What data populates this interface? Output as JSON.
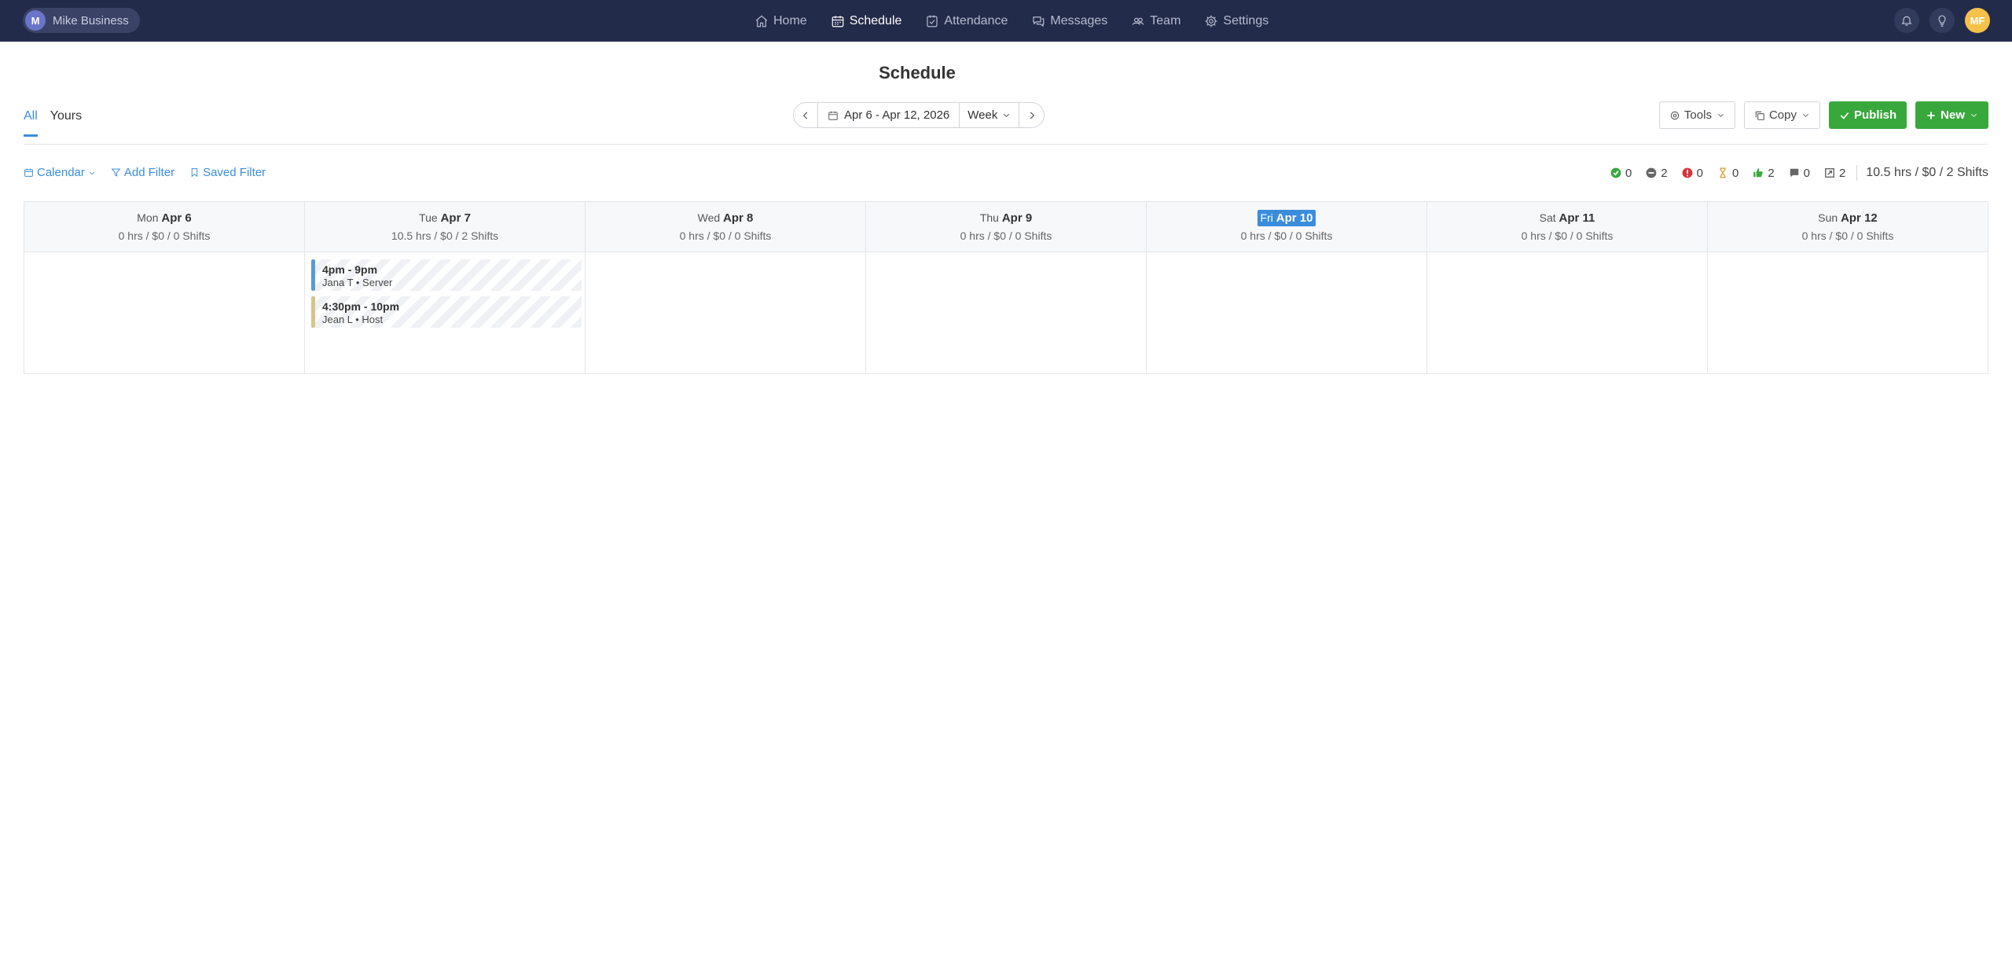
{
  "business": {
    "initial": "M",
    "name": "Mike Business"
  },
  "nav": [
    {
      "label": "Home",
      "icon": "home-icon"
    },
    {
      "label": "Schedule",
      "icon": "calendar-icon",
      "active": true
    },
    {
      "label": "Attendance",
      "icon": "clipboard-check-icon"
    },
    {
      "label": "Messages",
      "icon": "messages-icon"
    },
    {
      "label": "Team",
      "icon": "team-icon"
    },
    {
      "label": "Settings",
      "icon": "gear-icon"
    }
  ],
  "user": {
    "initials": "MF"
  },
  "page": {
    "title": "Schedule"
  },
  "tabs": [
    {
      "label": "All",
      "active": true
    },
    {
      "label": "Yours"
    }
  ],
  "date_nav": {
    "range": "Apr 6 - Apr 12, 2026",
    "view": "Week"
  },
  "actions": {
    "tools": "Tools",
    "copy": "Copy",
    "publish": "Publish",
    "new": "New"
  },
  "filters": {
    "calendar": "Calendar",
    "add_filter": "Add Filter",
    "saved_filter": "Saved Filter"
  },
  "stats": {
    "items": [
      {
        "name": "published-count",
        "value": "0",
        "color": "#38a83c"
      },
      {
        "name": "unpublished-count",
        "value": "2",
        "color": "#666666"
      },
      {
        "name": "conflicts-count",
        "value": "0",
        "color": "#d9303a"
      },
      {
        "name": "pending-count",
        "value": "0",
        "color": "#e39a2b"
      },
      {
        "name": "accepted-count",
        "value": "2",
        "color": "#38a83c"
      },
      {
        "name": "notes-count",
        "value": "0",
        "color": "#666666"
      },
      {
        "name": "open-shifts-count",
        "value": "2",
        "color": "#666666"
      }
    ],
    "total": "10.5 hrs / $0 / 2 Shifts"
  },
  "days": [
    {
      "dow": "Mon",
      "date": "Apr 6",
      "summary": "0 hrs / $0 / 0 Shifts",
      "today": false,
      "shifts": []
    },
    {
      "dow": "Tue",
      "date": "Apr 7",
      "summary": "10.5 hrs / $0 / 2 Shifts",
      "today": false,
      "shifts": [
        {
          "time": "4pm - 9pm",
          "who": "Jana T • Server",
          "color": "#5a9bd5"
        },
        {
          "time": "4:30pm - 10pm",
          "who": "Jean L • Host",
          "color": "#d9c38c"
        }
      ]
    },
    {
      "dow": "Wed",
      "date": "Apr 8",
      "summary": "0 hrs / $0 / 0 Shifts",
      "today": false,
      "shifts": []
    },
    {
      "dow": "Thu",
      "date": "Apr 9",
      "summary": "0 hrs / $0 / 0 Shifts",
      "today": false,
      "shifts": []
    },
    {
      "dow": "Fri",
      "date": "Apr 10",
      "summary": "0 hrs / $0 / 0 Shifts",
      "today": true,
      "shifts": []
    },
    {
      "dow": "Sat",
      "date": "Apr 11",
      "summary": "0 hrs / $0 / 0 Shifts",
      "today": false,
      "shifts": []
    },
    {
      "dow": "Sun",
      "date": "Apr 12",
      "summary": "0 hrs / $0 / 0 Shifts",
      "today": false,
      "shifts": []
    }
  ]
}
